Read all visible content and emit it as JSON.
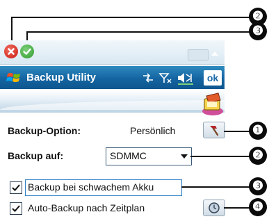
{
  "window": {
    "title": "Backup Utility",
    "ok_label": "ok"
  },
  "top_strip": {
    "close_button": "close",
    "confirm_button": "confirm",
    "keyboard_icon": "keyboard-icon"
  },
  "status_icons": [
    "connectivity-icon",
    "signal-icon",
    "volume-icon"
  ],
  "form": {
    "backup_option": {
      "label": "Backup-Option:",
      "value": "Persönlich"
    },
    "backup_to": {
      "label": "Backup auf:",
      "selected": "SDMMC"
    },
    "low_battery_backup": {
      "label": "Backup bei schwachem Akku",
      "checked": true
    },
    "scheduled_backup": {
      "label": "Auto-Backup nach Zeitplan",
      "checked": true
    }
  },
  "callouts": [
    "❷",
    "❸",
    "❶",
    "❷",
    "❸",
    "❹"
  ],
  "colors": {
    "titlebar": "#1464a1",
    "close": "#d9271e",
    "confirm": "#3ca63c",
    "focus": "#2d7fc4"
  }
}
